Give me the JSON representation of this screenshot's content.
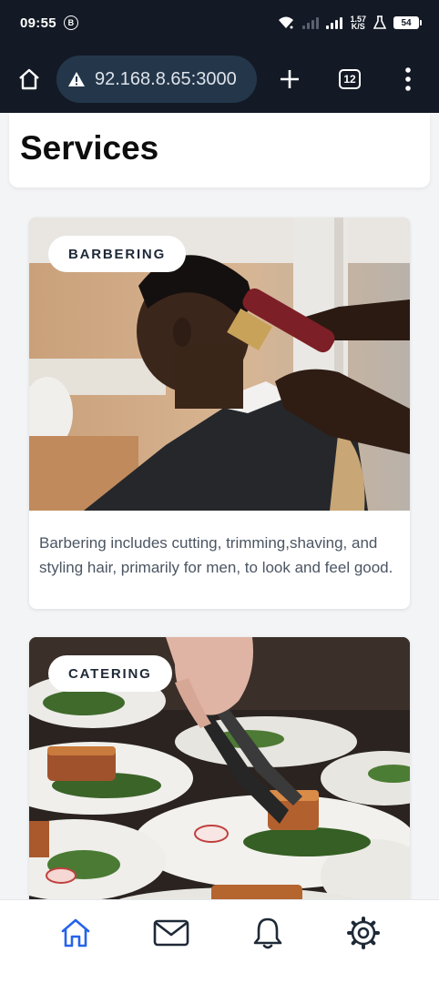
{
  "status_bar": {
    "time": "09:55",
    "notification_letter": "B",
    "net_speed_value": "1.57",
    "net_speed_unit": "K/S",
    "battery": "54"
  },
  "browser": {
    "url": "92.168.8.65:3000",
    "tab_count": "12"
  },
  "page": {
    "title": "Services"
  },
  "services": [
    {
      "badge": "BARBERING",
      "description": "Barbering includes cutting, trimming,shaving, and styling hair, primarily for men, to look and feel good."
    },
    {
      "badge": "CATERING",
      "description": ""
    }
  ],
  "bottom_nav": {
    "items": [
      "home-icon",
      "mail-icon",
      "bell-icon",
      "settings-icon"
    ],
    "active_color": "#2563eb",
    "inactive_color": "#1f2937"
  }
}
